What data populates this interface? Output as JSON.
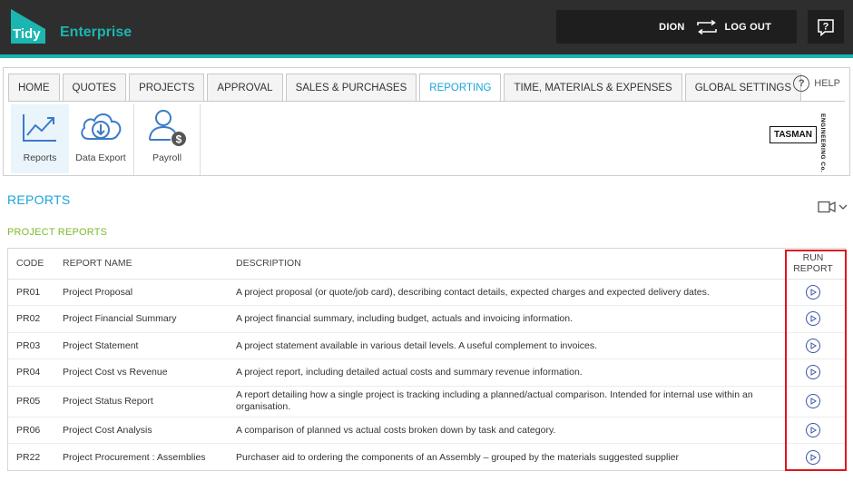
{
  "brand": {
    "name_part1": "Tidy",
    "name_part2": "Enterprise",
    "teal": "#1bb6b0"
  },
  "header": {
    "user": "DION",
    "logout_label": "LOG OUT",
    "help_icon": "question-box-icon"
  },
  "nav": {
    "tabs": [
      {
        "label": "HOME"
      },
      {
        "label": "QUOTES"
      },
      {
        "label": "PROJECTS"
      },
      {
        "label": "APPROVAL"
      },
      {
        "label": "SALES & PURCHASES"
      },
      {
        "label": "REPORTING",
        "active": true
      },
      {
        "label": "TIME, MATERIALS & EXPENSES"
      },
      {
        "label": "GLOBAL SETTINGS"
      }
    ],
    "help_label": "HELP",
    "subnav": [
      {
        "label": "Reports",
        "icon": "chart-trend-icon",
        "active": true
      },
      {
        "label": "Data Export",
        "icon": "cloud-download-icon"
      },
      {
        "label": "Payroll",
        "icon": "user-dollar-icon"
      }
    ],
    "company_logo": {
      "name": "TASMAN",
      "vertical": "ENGINEERING Co."
    }
  },
  "page": {
    "title": "REPORTS",
    "section_title": "PROJECT REPORTS"
  },
  "table": {
    "headers": {
      "code": "CODE",
      "name": "REPORT NAME",
      "description": "DESCRIPTION",
      "run": "RUN REPORT"
    },
    "rows": [
      {
        "code": "PR01",
        "name": "Project Proposal",
        "description": "A project proposal (or quote/job card), describing contact details, expected charges and expected delivery dates."
      },
      {
        "code": "PR02",
        "name": "Project Financial Summary",
        "description": "A project financial summary, including budget, actuals and invoicing information."
      },
      {
        "code": "PR03",
        "name": "Project Statement",
        "description": "A project statement available in various detail levels. A useful complement to invoices."
      },
      {
        "code": "PR04",
        "name": "Project Cost vs Revenue",
        "description": "A project report, including detailed actual costs and summary revenue information."
      },
      {
        "code": "PR05",
        "name": "Project Status Report",
        "description": "A report detailing how a single project is tracking including a planned/actual comparison. Intended for internal use within an organisation."
      },
      {
        "code": "PR06",
        "name": "Project Cost Analysis",
        "description": "A comparison of planned vs actual costs broken down by task and category."
      },
      {
        "code": "PR22",
        "name": "Project Procurement : Assemblies",
        "description": "Purchaser aid to ordering the components of an Assembly – grouped by the materials suggested supplier"
      }
    ]
  },
  "colors": {
    "accent_blue": "#1ba5d8",
    "section_green": "#7dbb2a",
    "highlight_red": "#e0141b",
    "play_blue": "#3a55a4"
  }
}
